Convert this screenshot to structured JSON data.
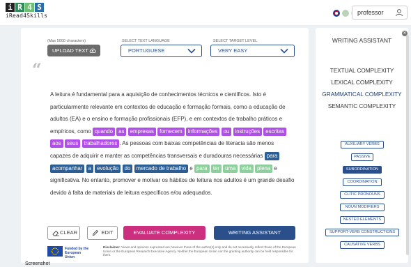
{
  "header": {
    "logo_tiles": [
      "i",
      "R",
      "4",
      "S"
    ],
    "logo_subtitle": "iRead4Skills",
    "user": "professor",
    "flag_colors": [
      "#c8102e",
      "#b0c8b0",
      "#f0c89c",
      "#e8a0a0"
    ]
  },
  "controls": {
    "max_chars_note": "(Max 5000 characters)",
    "upload_label": "UPLOAD TEXT",
    "language_label": "SELECT TEXT LANGUAGE",
    "language_value": "PORTUGUESE",
    "level_label": "SELECT TARGET LEVEL",
    "level_value": "VERY EASY"
  },
  "text": {
    "p1": "A leitura é fundamental para a aquisição de conhecimentos técnicos e científicos. Isto é particularmente relevante em contextos de educação e formação formais, como a educação de adultos (EA) e o ensino e formação profissionais (EFP), e em contextos de trabalho práticos e empíricos, como ",
    "purple_tags_1": [
      "quando",
      "as",
      "empresas",
      "fornecem",
      "informações",
      "ou",
      "instruções"
    ],
    "purple_tags_2": [
      "escritas",
      "aos",
      "seus",
      "trabalhadores"
    ],
    "p2": ". As pessoas com baixas competências de literacia são menos capazes de adquirir e manter as competências transversais e duradouras necessárias",
    "blue_tags": [
      "para",
      "acompanhar",
      "a",
      "evolução",
      "do",
      "mercado de trabalho"
    ],
    "e_word": "e",
    "green_tags_1": [
      "para",
      "ter",
      "uma",
      "vida"
    ],
    "green_tags_2": [
      "plena"
    ],
    "p3": " e significativa. No entanto, promover e motivar os hábitos de leitura nos adultos é um grande desafio devido à falta de materiais de leitura específicos e/ou adequados."
  },
  "buttons": {
    "clear": "CLEAR",
    "edit": "EDIT",
    "evaluate": "EVALUATE COMPLEXITY",
    "writing_assistant": "WRITING ASSISTANT"
  },
  "footer": {
    "eu_text": "Funded by the European Union",
    "disclaimer_bold": "Disclaimer:",
    "disclaimer": "Views and opinions expressed are however those of the author(s) only and do not necessarily reflect those of the European Union or the European Research Executive Agency. Neither the European Union nor the granting authority can be held responsible for them."
  },
  "side": {
    "title": "WRITING ASSISTANT",
    "categories": [
      "TEXTUAL COMPLEXITY",
      "LEXICAL COMPLEXITY",
      "GRAMMATICAL COMPLEXITY",
      "SEMANTIC COMPLEXITY"
    ],
    "active_category": "GRAMMATICAL COMPLEXITY",
    "features": [
      "AUXILIARY VERBS",
      "PASSIVE",
      "SUBORDINATION",
      "COORDINATION",
      "CLITIC PRONOUNS",
      "NOUN MODIFIERS",
      "NESTED ELEMENTS",
      "SUPPORT-VERB CONSTRUCTIONS",
      "CAUSATIVE VERBS"
    ],
    "active_feature": "SUBORDINATION"
  },
  "caption": "Screenshot"
}
